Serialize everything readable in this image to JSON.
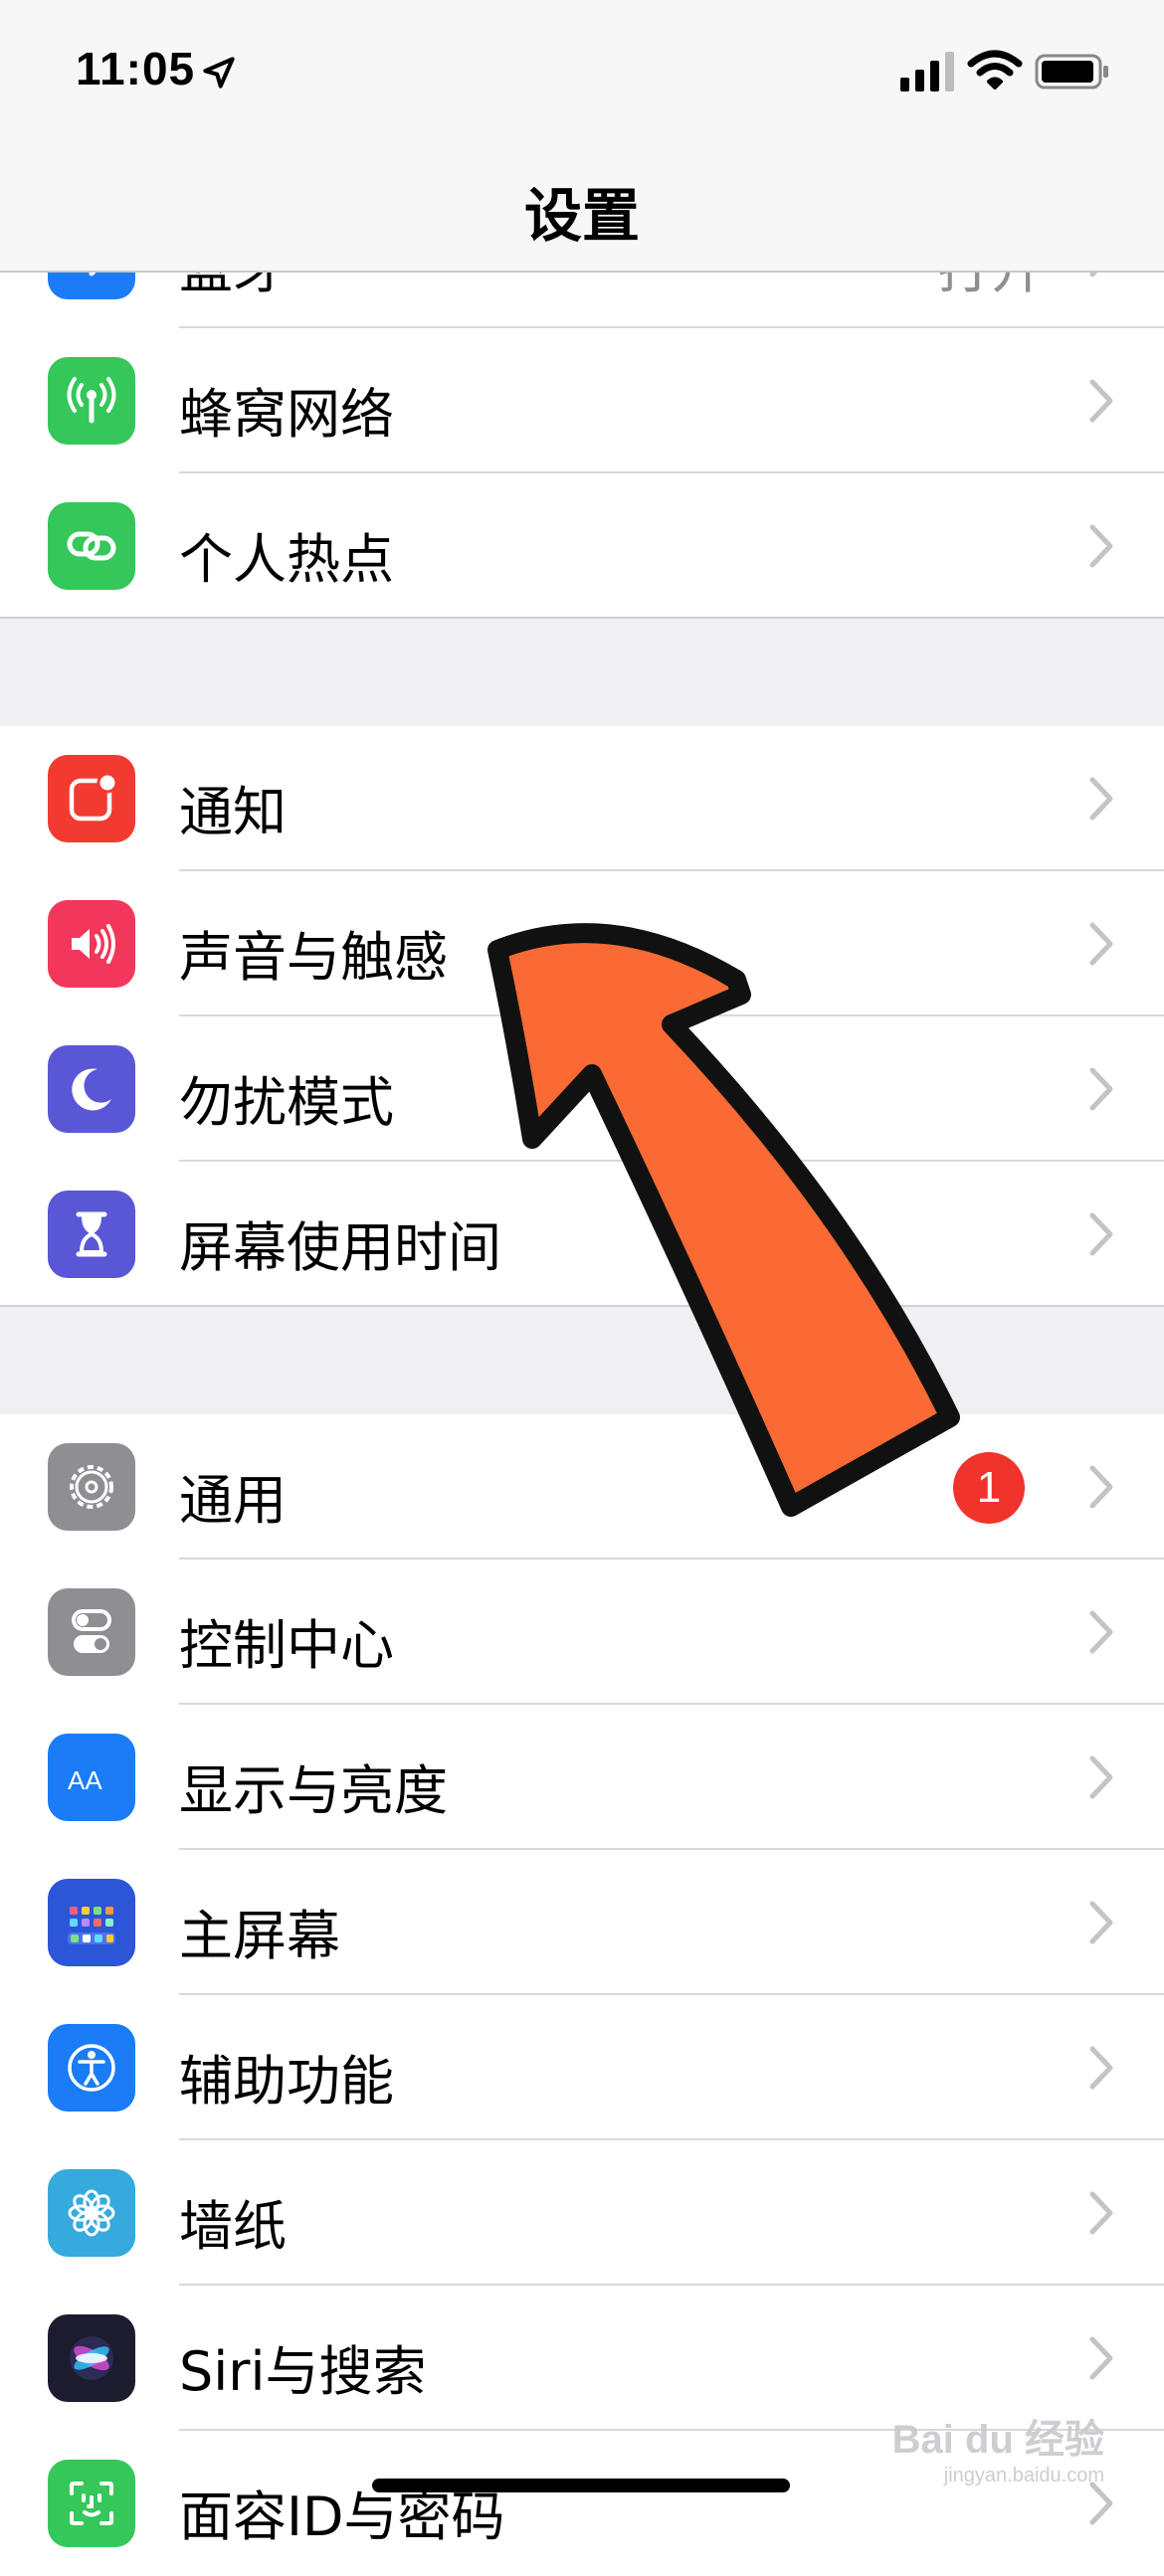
{
  "status": {
    "time": "11:05"
  },
  "nav": {
    "title": "设置"
  },
  "groups": [
    {
      "items": [
        {
          "label": "蓝牙",
          "value": "打开",
          "icon": "bluetooth-icon",
          "color": "#1a7cf6"
        },
        {
          "label": "蜂窝网络",
          "icon": "cellular-icon",
          "color": "#35c759"
        },
        {
          "label": "个人热点",
          "icon": "hotspot-icon",
          "color": "#35c759"
        }
      ]
    },
    {
      "items": [
        {
          "label": "通知",
          "icon": "notifications-icon",
          "color": "#f23a30"
        },
        {
          "label": "声音与触感",
          "icon": "sound-icon",
          "color": "#f2375a"
        },
        {
          "label": "勿扰模式",
          "icon": "moon-icon",
          "color": "#5a57d6"
        },
        {
          "label": "屏幕使用时间",
          "icon": "hourglass-icon",
          "color": "#5a57d6"
        }
      ]
    },
    {
      "items": [
        {
          "label": "通用",
          "icon": "gear-icon",
          "color": "#8e8e93",
          "badge": "1"
        },
        {
          "label": "控制中心",
          "icon": "toggles-icon",
          "color": "#8e8e93"
        },
        {
          "label": "显示与亮度",
          "icon": "display-icon",
          "color": "#1a7cf6"
        },
        {
          "label": "主屏幕",
          "icon": "home-screen-icon",
          "color": "#2c55d8"
        },
        {
          "label": "辅助功能",
          "icon": "accessibility-icon",
          "color": "#1a7cf6"
        },
        {
          "label": "墙纸",
          "icon": "wallpaper-icon",
          "color": "#36aadc"
        },
        {
          "label": "Siri与搜索",
          "icon": "siri-icon",
          "color": "#1c1c2e"
        },
        {
          "label": "面容ID与密码",
          "icon": "faceid-icon",
          "color": "#35c759"
        }
      ]
    }
  ],
  "annotation": {
    "arrow_color": "#f96a35"
  },
  "watermark": {
    "text": "Bai du 经验",
    "sub": "jingyan.baidu.com"
  }
}
